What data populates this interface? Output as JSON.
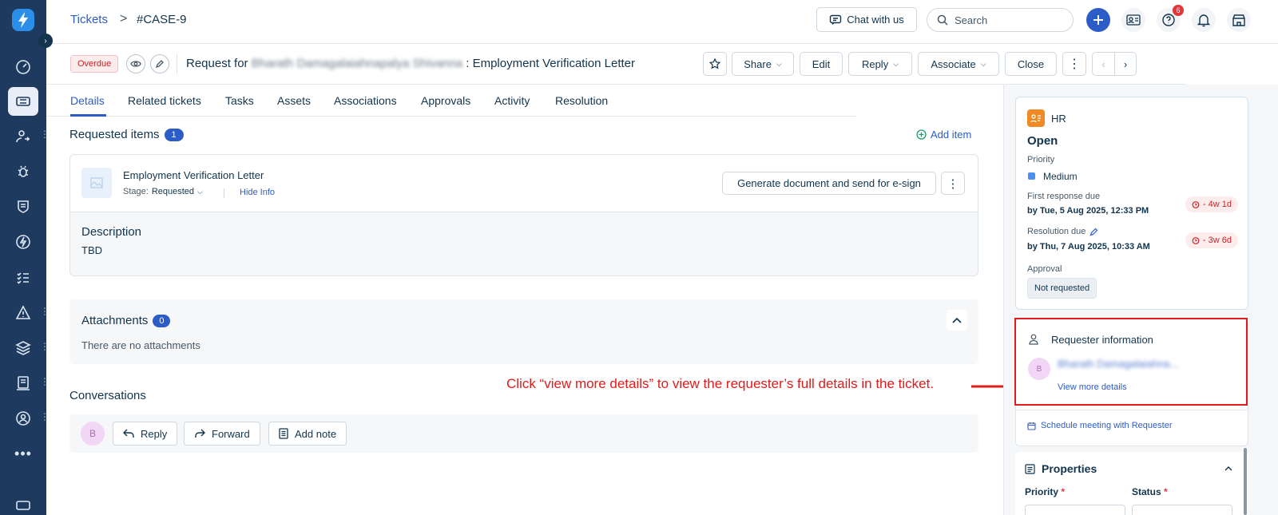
{
  "sidebar": {
    "items": [
      {
        "icon": "bolt-logo-icon"
      },
      {
        "icon": "gauge-icon"
      },
      {
        "icon": "ticket-icon"
      },
      {
        "icon": "user-switch-icon"
      },
      {
        "icon": "bug-icon"
      },
      {
        "icon": "shield-icon"
      },
      {
        "icon": "lightning-circle-icon"
      },
      {
        "icon": "checklist-icon"
      },
      {
        "icon": "warning-icon"
      },
      {
        "icon": "layers-icon"
      },
      {
        "icon": "document-icon"
      },
      {
        "icon": "people-circle-icon"
      },
      {
        "icon": "more-icon"
      }
    ]
  },
  "topbar": {
    "breadcrumb_link": "Tickets",
    "breadcrumb_sep": ">",
    "breadcrumb_current": "#CASE-9",
    "chat_label": "Chat with us",
    "search_placeholder": "Search",
    "help_badge": "6"
  },
  "ticket": {
    "status_tag": "Overdue",
    "subject_prefix": "Request for",
    "requester_name_blurred": "Bharath Damagalaiahnapalya Shivanna",
    "subject_suffix": ": Employment Verification Letter",
    "actions": {
      "share": "Share",
      "edit": "Edit",
      "reply": "Reply",
      "associate": "Associate",
      "close": "Close"
    }
  },
  "tabs": [
    "Details",
    "Related tickets",
    "Tasks",
    "Assets",
    "Associations",
    "Approvals",
    "Activity",
    "Resolution"
  ],
  "requested_items": {
    "title": "Requested items",
    "count": "1",
    "add_label": "Add item",
    "item_name": "Employment Verification Letter",
    "stage_label": "Stage:",
    "stage_value": "Requested",
    "hide_info": "Hide Info",
    "generate_btn": "Generate document and send for e-sign",
    "description_title": "Description",
    "description_value": "TBD"
  },
  "attachments": {
    "title": "Attachments",
    "count": "0",
    "empty": "There are no attachments"
  },
  "conversations": {
    "title": "Conversations",
    "avatar": "B",
    "reply": "Reply",
    "forward": "Forward",
    "add_note": "Add note"
  },
  "annotation": "Click “view more details” to view the requester’s full details in the ticket.",
  "right_panel": {
    "group": "HR",
    "status": "Open",
    "priority_label": "Priority",
    "priority_value": "Medium",
    "first_response_label": "First response due",
    "first_response_value": "by Tue, 5 Aug 2025, 12:33 PM",
    "first_response_chip": "- 4w 1d",
    "resolution_label": "Resolution due",
    "resolution_value": "by Thu, 7 Aug 2025, 10:33 AM",
    "resolution_chip": "- 3w 6d",
    "approval_label": "Approval",
    "approval_value": "Not requested",
    "requester_title": "Requester information",
    "requester_avatar": "B",
    "requester_name": "Bharath Damagalaiahna...",
    "view_more": "View more details",
    "schedule": "Schedule meeting with Requester",
    "properties_title": "Properties",
    "prop_priority": "Priority",
    "prop_status": "Status",
    "required_mark": "*"
  },
  "colors": {
    "sidebar_bg": "#1f3a5f",
    "link_blue": "#2c5cc5",
    "overdue_red": "#c82124",
    "annotation_red": "#e01b1b",
    "hr_orange": "#f08a24"
  }
}
